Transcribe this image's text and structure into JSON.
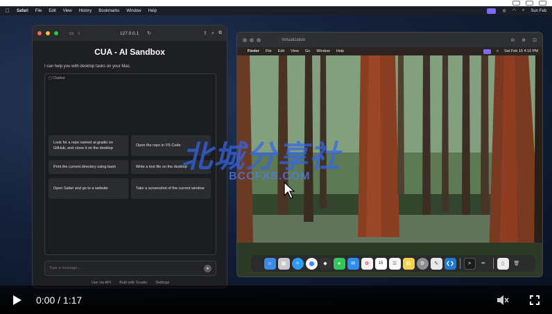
{
  "mac_menubar": {
    "apple": "",
    "items": [
      "Safari",
      "File",
      "Edit",
      "View",
      "History",
      "Bookmarks",
      "Window",
      "Help"
    ],
    "clock": "Sun Feb"
  },
  "safari": {
    "url": "127.0.0.1",
    "title": "CUA - AI Sandbox",
    "subtitle": "I can help you with desktop tasks on your Mac.",
    "chat_label": "Chatbot",
    "suggestions": [
      "Look for a repo named ai-gradio on GitHub, and clone it on the desktop",
      "Open the repo in VS Code",
      "Print the current directory using bash",
      "Write a text file on the desktop",
      "Open Safari and go to a website",
      "Take a screenshot of the current window"
    ],
    "input_placeholder": "Type a message...",
    "footer": [
      "Use via API",
      "Built with Gradio",
      "Settings"
    ]
  },
  "vm": {
    "title": "Virtualization",
    "menubar": [
      "",
      "Finder",
      "File",
      "Edit",
      "View",
      "Go",
      "Window",
      "Help"
    ],
    "clock": "Sat Feb 15  4:10 PM",
    "calendar_day": "15"
  },
  "watermark": {
    "main": "北城分享社",
    "sub": "BCCFXS.COM"
  },
  "video": {
    "time": "0:00 / 1:17"
  },
  "colors": {
    "accent": "#7b6cf6",
    "watermark": "#3466e8"
  }
}
